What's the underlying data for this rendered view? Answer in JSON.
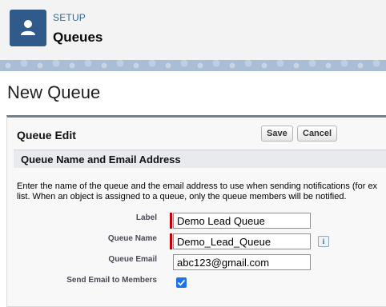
{
  "header": {
    "eyebrow": "SETUP",
    "title": "Queues",
    "icon": "user-icon"
  },
  "page": {
    "title": "New Queue"
  },
  "panel": {
    "title": "Queue Edit",
    "save_label": "Save",
    "cancel_label": "Cancel",
    "section_title": "Queue Name and Email Address",
    "instructions_line1": "Enter the name of the queue and the email address to use when sending notifications (for ex",
    "instructions_line2": "list. When an object is assigned to a queue, only the queue members will be notified."
  },
  "form": {
    "label_label": "Label",
    "label_value": "Demo Lead Queue",
    "queue_name_label": "Queue Name",
    "queue_name_value": "Demo_Lead_Queue",
    "info_glyph": "i",
    "queue_email_label": "Queue Email",
    "queue_email_value": "abc123@gmail.com",
    "send_email_label": "Send Email to Members",
    "send_email_checked": true
  },
  "colors": {
    "accent": "#2f5a8a",
    "required": "#c00000",
    "checkbox": "#1a73e8"
  }
}
